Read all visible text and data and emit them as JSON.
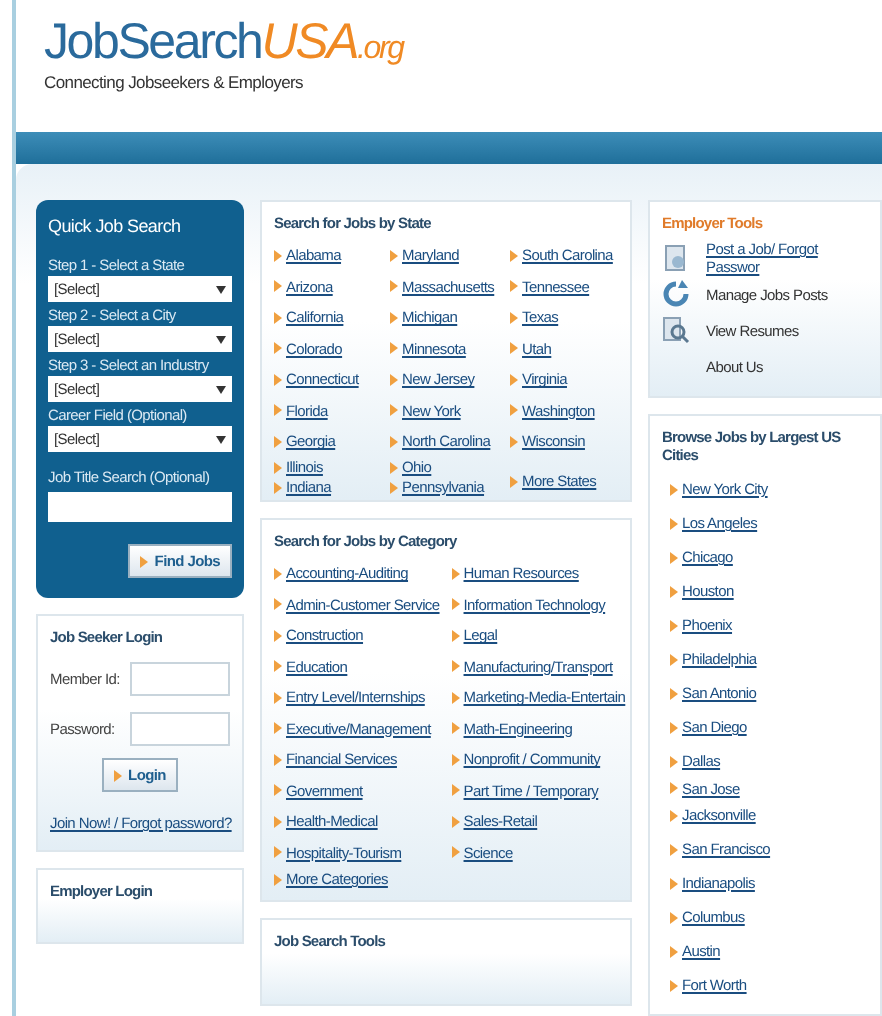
{
  "logo": {
    "brand": "JobSearch",
    "accent": "USA",
    "suffix": ".org",
    "tagline": "Connecting Jobseekers & Employers"
  },
  "quick_search": {
    "title": "Quick Job Search",
    "fields": [
      {
        "kind": "select",
        "label": "Step 1 - Select a State",
        "value": "[Select]"
      },
      {
        "kind": "select",
        "label": "Step 2 - Select a City",
        "value": "[Select]"
      },
      {
        "kind": "select",
        "label": "Step 3 - Select an Industry",
        "value": "[Select]"
      },
      {
        "kind": "select",
        "label": "Career Field (Optional)",
        "value": "[Select]"
      },
      {
        "kind": "text",
        "label": "Job Title Search (Optional)"
      }
    ],
    "button": "Find Jobs"
  },
  "job_seeker_login": {
    "title": "Job Seeker Login",
    "fields": [
      {
        "label": "Member Id:"
      },
      {
        "label": "Password:"
      }
    ],
    "button": "Login",
    "link": "Join Now! / Forgot password?"
  },
  "employer_login": {
    "title": "Employer Login"
  },
  "states": {
    "title": "Search for Jobs by State",
    "columns": [
      [
        "Alabama",
        "Arizona",
        "California",
        "Colorado",
        "Connecticut",
        "Florida",
        "Georgia",
        "Illinois",
        "Indiana"
      ],
      [
        "Maryland",
        "Massachusetts",
        "Michigan",
        "Minnesota",
        "New Jersey",
        "New York",
        "North Carolina",
        "Ohio",
        "Pennsylvania"
      ],
      [
        "South Carolina",
        "Tennessee",
        "Texas",
        "Utah",
        "Virginia",
        "Washington",
        "Wisconsin"
      ]
    ],
    "more": "More States"
  },
  "categories": {
    "title": "Search for Jobs by Category",
    "columns": [
      [
        "Accounting-Auditing",
        "Admin-Customer Service",
        "Construction",
        "Education",
        "Entry Level/Internships",
        "Executive/Management",
        "Financial Services",
        "Government",
        "Health-Medical",
        "Hospitality-Tourism"
      ],
      [
        "Human Resources",
        "Information Technology",
        "Legal",
        "Manufacturing/Transport",
        "Marketing-Media-Entertain",
        "Math-Engineering",
        "Nonprofit / Community",
        "Part Time / Temporary",
        "Sales-Retail",
        "Science"
      ]
    ],
    "more": "More Categories"
  },
  "job_search_tools": {
    "title": "Job Search Tools"
  },
  "employer_tools": {
    "title": "Employer Tools",
    "items": [
      {
        "kind": "document",
        "label": "Post a Job/ Forgot Passwor",
        "link": true
      },
      {
        "kind": "refresh",
        "label": "Manage Jobs Posts",
        "link": false
      },
      {
        "kind": "magnifier",
        "label": "View Resumes",
        "link": false
      },
      {
        "kind": "none",
        "label": "About Us",
        "link": false
      }
    ]
  },
  "cities": {
    "title": "Browse Jobs by Largest US Cities",
    "items": [
      "New York City",
      "Los Angeles",
      "Chicago",
      "Houston",
      "Phoenix",
      "Philadelphia",
      "San Antonio",
      "San Diego",
      "Dallas",
      "San Jose",
      "Jacksonville",
      "San Francisco",
      "Indianapolis",
      "Columbus",
      "Austin",
      "Fort Worth"
    ]
  }
}
